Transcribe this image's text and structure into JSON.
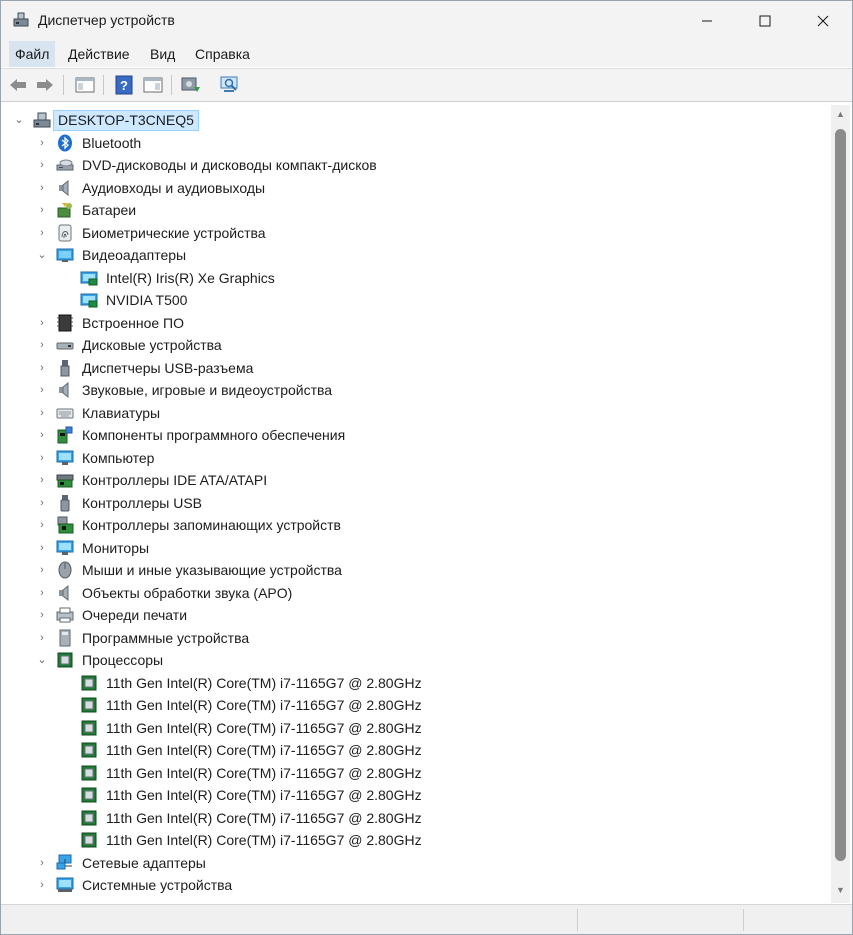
{
  "window": {
    "title": "Диспетчер устройств"
  },
  "menu": {
    "file": "Файл",
    "action": "Действие",
    "view": "Вид",
    "help": "Справка"
  },
  "tree": {
    "root": "DESKTOP-T3CNEQ5",
    "items": [
      {
        "label": "Bluetooth",
        "icon": "bluetooth-icon",
        "expanded": false
      },
      {
        "label": "DVD-дисководы и дисководы компакт-дисков",
        "icon": "dvd-drive-icon",
        "expanded": false
      },
      {
        "label": "Аудиовходы и аудиовыходы",
        "icon": "speaker-icon",
        "expanded": false
      },
      {
        "label": "Батареи",
        "icon": "battery-icon",
        "expanded": false
      },
      {
        "label": "Биометрические устройства",
        "icon": "fingerprint-icon",
        "expanded": false
      },
      {
        "label": "Видеоадаптеры",
        "icon": "display-adapter-icon",
        "expanded": true,
        "children": [
          "Intel(R) Iris(R) Xe Graphics",
          "NVIDIA T500"
        ]
      },
      {
        "label": "Встроенное ПО",
        "icon": "firmware-icon",
        "expanded": false
      },
      {
        "label": "Дисковые устройства",
        "icon": "disk-drive-icon",
        "expanded": false
      },
      {
        "label": "Диспетчеры USB-разъема",
        "icon": "usb-connector-icon",
        "expanded": false
      },
      {
        "label": "Звуковые, игровые и видеоустройства",
        "icon": "speaker-icon",
        "expanded": false
      },
      {
        "label": "Клавиатуры",
        "icon": "keyboard-icon",
        "expanded": false
      },
      {
        "label": "Компоненты программного обеспечения",
        "icon": "software-component-icon",
        "expanded": false
      },
      {
        "label": "Компьютер",
        "icon": "computer-icon",
        "expanded": false
      },
      {
        "label": "Контроллеры IDE ATA/ATAPI",
        "icon": "ide-controller-icon",
        "expanded": false
      },
      {
        "label": "Контроллеры USB",
        "icon": "usb-icon",
        "expanded": false
      },
      {
        "label": "Контроллеры запоминающих устройств",
        "icon": "storage-controller-icon",
        "expanded": false
      },
      {
        "label": "Мониторы",
        "icon": "monitor-icon",
        "expanded": false
      },
      {
        "label": "Мыши и иные указывающие устройства",
        "icon": "mouse-icon",
        "expanded": false
      },
      {
        "label": "Объекты обработки звука (APO)",
        "icon": "speaker-icon",
        "expanded": false
      },
      {
        "label": "Очереди печати",
        "icon": "printer-icon",
        "expanded": false
      },
      {
        "label": "Программные устройства",
        "icon": "software-device-icon",
        "expanded": false
      },
      {
        "label": "Процессоры",
        "icon": "processor-icon",
        "expanded": true,
        "children": [
          "11th Gen Intel(R) Core(TM) i7-1165G7 @ 2.80GHz",
          "11th Gen Intel(R) Core(TM) i7-1165G7 @ 2.80GHz",
          "11th Gen Intel(R) Core(TM) i7-1165G7 @ 2.80GHz",
          "11th Gen Intel(R) Core(TM) i7-1165G7 @ 2.80GHz",
          "11th Gen Intel(R) Core(TM) i7-1165G7 @ 2.80GHz",
          "11th Gen Intel(R) Core(TM) i7-1165G7 @ 2.80GHz",
          "11th Gen Intel(R) Core(TM) i7-1165G7 @ 2.80GHz",
          "11th Gen Intel(R) Core(TM) i7-1165G7 @ 2.80GHz"
        ]
      },
      {
        "label": "Сетевые адаптеры",
        "icon": "network-adapter-icon",
        "expanded": false
      },
      {
        "label": "Системные устройства",
        "icon": "system-device-icon",
        "expanded": false
      }
    ]
  },
  "colors": {
    "selection": "#cde8ff",
    "accent": "#0078d4"
  }
}
